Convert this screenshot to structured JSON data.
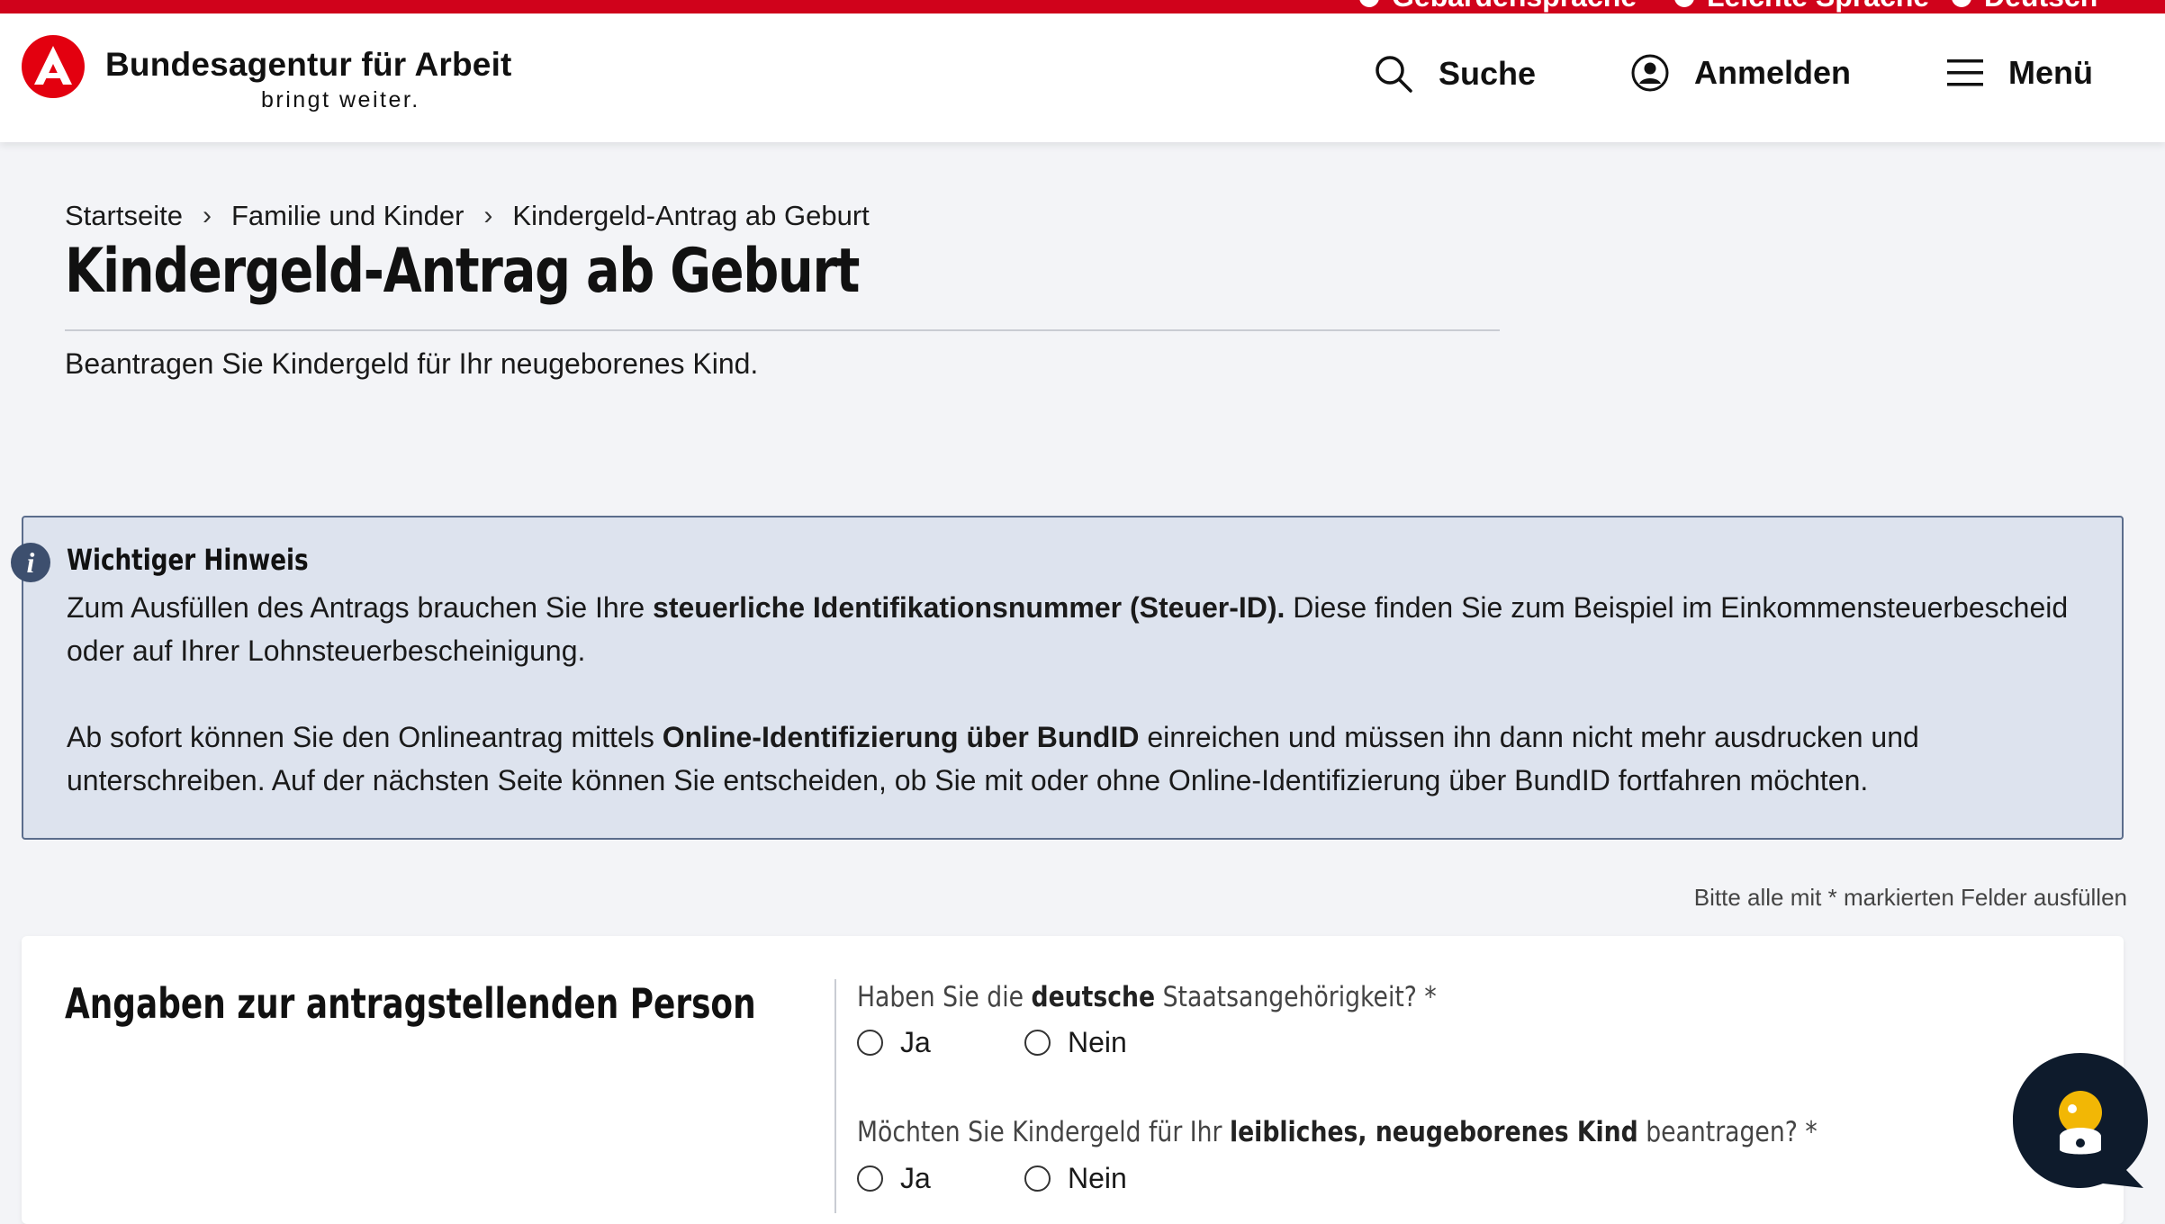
{
  "utility_bar": {
    "items": [
      "Gebärdensprache",
      "Leichte Sprache",
      "Deutsch"
    ]
  },
  "header": {
    "brand": "Bundesagentur für Arbeit",
    "slogan": "bringt weiter.",
    "search_label": "Suche",
    "login_label": "Anmelden",
    "menu_label": "Menü"
  },
  "breadcrumb": {
    "items": [
      "Startseite",
      "Familie und Kinder",
      "Kindergeld-Antrag ab Geburt"
    ]
  },
  "page": {
    "title": "Kindergeld-Antrag ab Geburt",
    "intro": "Beantragen Sie Kindergeld für Ihr neugeborenes Kind."
  },
  "notice": {
    "title": "Wichtiger Hinweis",
    "p1_a": "Zum Ausfüllen des Antrags brauchen Sie Ihre ",
    "p1_b": "steuerliche Identifikationsnummer (Steuer-ID).",
    "p1_c": " Diese finden Sie zum Beispiel im Einkommensteuerbescheid oder auf Ihrer Lohnsteuerbescheinigung.",
    "p2_a": "Ab sofort können Sie den Onlineantrag mittels ",
    "p2_b": "Online-Identifizierung über BundID",
    "p2_c": " einreichen und müssen ihn dann nicht mehr ausdrucken und unterschreiben. Auf der nächsten Seite können Sie entscheiden, ob Sie mit oder ohne Online-Identifizierung über BundID fortfahren möchten."
  },
  "required_hint": "Bitte alle mit * markierten Felder ausfüllen",
  "form": {
    "section_title": "Angaben zur antragstellenden Person",
    "q1": {
      "pre": "Haben Sie die ",
      "bold": "deutsche",
      "post": " Staatsangehörigkeit? *",
      "options": [
        "Ja",
        "Nein"
      ]
    },
    "q2": {
      "pre": "Möchten Sie Kindergeld für Ihr ",
      "bold": "leibliches, neugeborenes Kind",
      "post": " beantragen? *",
      "options": [
        "Ja",
        "Nein"
      ]
    }
  },
  "colors": {
    "brand_red": "#d0021b",
    "notice_bg": "#dde3ee",
    "notice_border": "#5b6d8c",
    "chatbot_bg": "#0e1b2c",
    "chatbot_accent": "#f2b705"
  },
  "icons": [
    "ba-logo-icon",
    "search-icon",
    "user-circle-icon",
    "hamburger-icon",
    "chevron-right-icon",
    "info-icon",
    "chatbot-icon"
  ]
}
